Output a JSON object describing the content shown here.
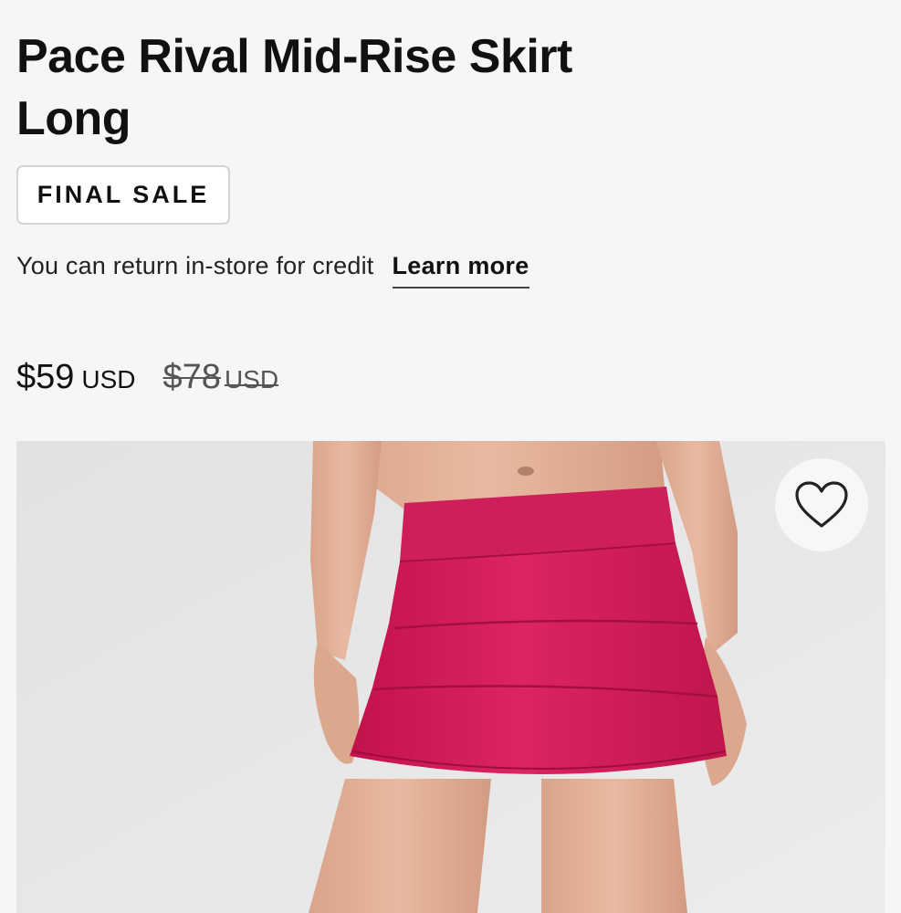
{
  "product": {
    "title": "Pace Rival Mid-Rise Skirt Long",
    "badge": "FINAL SALE",
    "return_text": "You can return in-store for credit",
    "learn_more": "Learn more"
  },
  "price": {
    "current": "$59",
    "current_currency": "USD",
    "original": "$78",
    "original_currency": "USD"
  },
  "image": {
    "subject": "pink skirt worn by model",
    "skirt_color": "#d81e5b",
    "background_color": "#e6e6e7"
  },
  "icons": {
    "wishlist": "heart-icon"
  }
}
